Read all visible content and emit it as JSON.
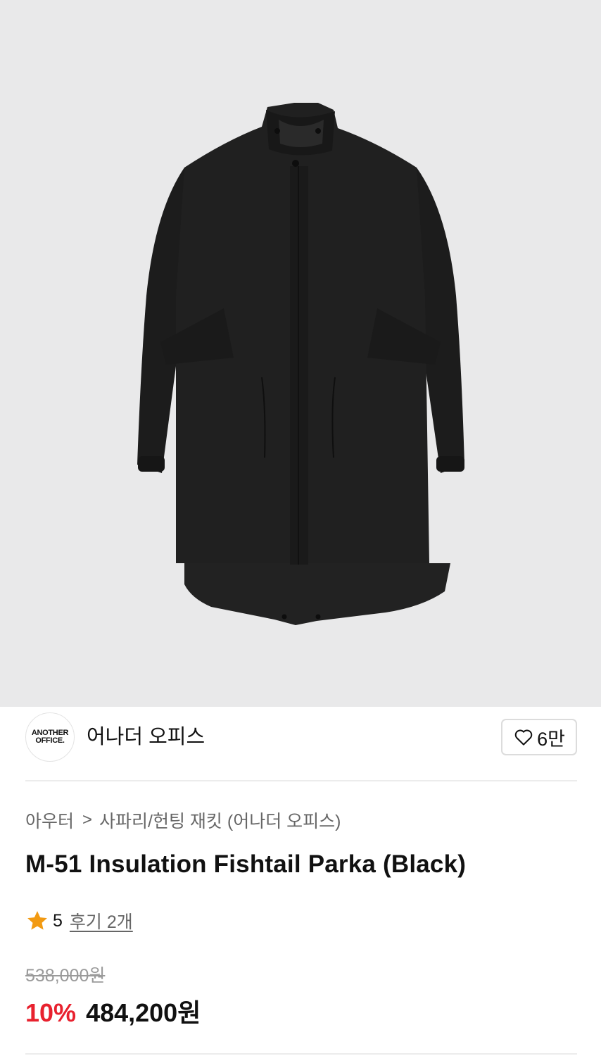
{
  "product_image": {
    "alt": "M-51 Insulation Fishtail Parka (Black)",
    "background": "#e9e9ea",
    "garment_color": "#1f1f1f"
  },
  "brand": {
    "logo_line1": "ANOTHER",
    "logo_line2": "OFFICE.",
    "name": "어나더 오피스"
  },
  "like": {
    "icon": "heart-icon",
    "count": "6만"
  },
  "breadcrumb": {
    "category": "아우터",
    "separator": ">",
    "subcategory": "사파리/헌팅 재킷 (어나더 오피스)"
  },
  "product": {
    "title": "M-51 Insulation Fishtail Parka (Black)"
  },
  "rating": {
    "icon": "star-icon",
    "score": "5",
    "reviews": "후기 2개"
  },
  "price": {
    "original": "538,000원",
    "discount": "10%",
    "sale": "484,200원",
    "discount_color": "#e8212e"
  }
}
